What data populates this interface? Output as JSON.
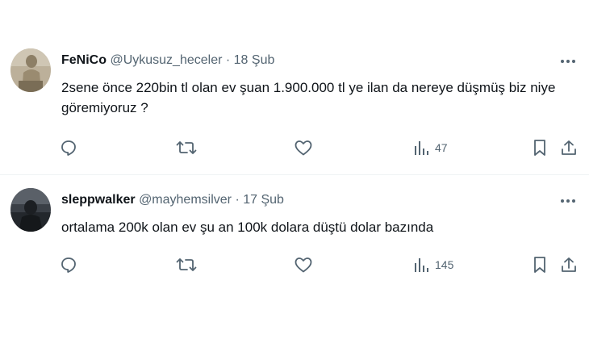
{
  "tweets": [
    {
      "display_name": "FeNiCo",
      "handle": "@Uykusuz_heceler",
      "separator": "·",
      "date": "18 Şub",
      "text": "2sene önce 220bin tl olan ev şuan 1.900.000 tl ye ilan da nereye düşmüş biz niye göremiyoruz ?",
      "views": "47",
      "avatar_icon": "statue-photo-avatar"
    },
    {
      "display_name": "sleppwalker",
      "handle": "@mayhemsilver",
      "separator": "·",
      "date": "17 Şub",
      "text": "ortalama 200k olan ev şu an 100k dolara düştü dolar bazında",
      "views": "145",
      "avatar_icon": "dark-figure-avatar"
    }
  ],
  "icons": {
    "reply": "reply-icon",
    "retweet": "retweet-icon",
    "like": "heart-icon",
    "views": "views-chart-icon",
    "bookmark": "bookmark-icon",
    "share": "share-icon",
    "more": "more-options-icon"
  },
  "colors": {
    "text_primary": "#0f1419",
    "text_secondary": "#536471",
    "divider": "#eff3f4"
  }
}
